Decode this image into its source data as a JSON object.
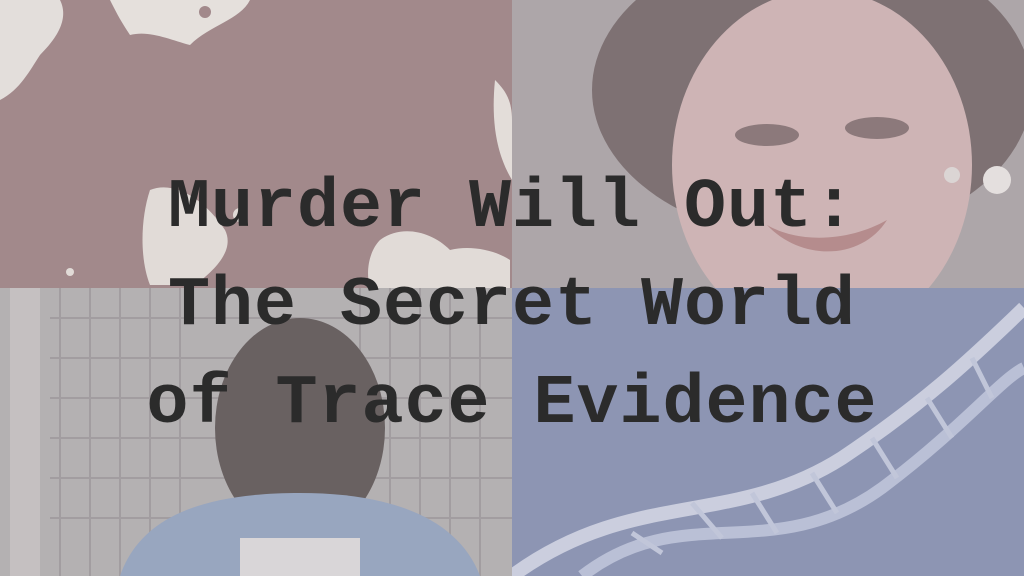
{
  "title_lines": [
    "Murder Will Out:",
    "The Secret World",
    "of Trace Evidence"
  ],
  "panels": [
    {
      "name": "blood-splatter-photo",
      "tint": "#8f6f70"
    },
    {
      "name": "woman-portrait-photo",
      "tint": "#a8a0a3"
    },
    {
      "name": "man-behind-fence-photo",
      "tint": "#a4a0a1"
    },
    {
      "name": "dna-helix-photo",
      "tint": "#7b87a8"
    }
  ],
  "colors": {
    "title_text": "#2b2b2b",
    "overlay": "#dcd7da"
  }
}
